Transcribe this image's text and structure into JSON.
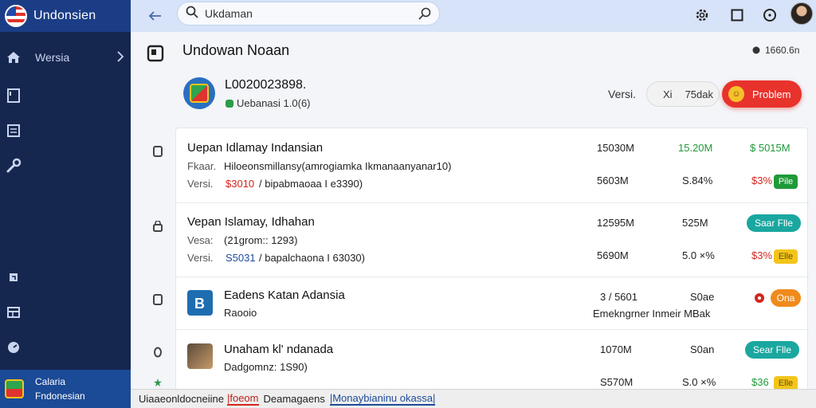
{
  "app": {
    "title": "Undonsien"
  },
  "sidebar": {
    "items": [
      {
        "label": "Wersia",
        "icon": "home-icon"
      },
      {
        "label": "",
        "icon": "document-icon"
      },
      {
        "label": "",
        "icon": "news-icon"
      },
      {
        "label": "",
        "icon": "wrench-icon"
      },
      {
        "label": "",
        "icon": "refresh-icon"
      },
      {
        "label": "",
        "icon": "table-icon"
      },
      {
        "label": "",
        "icon": "dashboard-icon"
      }
    ],
    "footer": {
      "line1": "Calaria",
      "line2": "Fndonesian"
    }
  },
  "topbar": {
    "search": {
      "value": "Ukdaman",
      "placeholder": "Ukdaman"
    },
    "icons": [
      "gear-icon",
      "square-icon",
      "help-icon",
      "avatar"
    ]
  },
  "page": {
    "title": "Undowan Noaan",
    "meta": "1660.6n"
  },
  "summary": {
    "id": "L0020023898.",
    "sub": "Uebanasi 1.0(6)",
    "versi_label": "Versi.",
    "version_x": "Xi",
    "version_value": "75dak",
    "problem_label": "Problem"
  },
  "rows": [
    {
      "title": "Uepan Idlamay Indansian",
      "line2_label": "Fkaar.",
      "line2_text": "Hiloeonsmillansy(amrogiamka Ikmanaanyanar10)",
      "line3_label": "Versi.",
      "line3_value": "$3010",
      "line3_text": "/ bipabmaoaa I e3390)",
      "col1_a": "15030M",
      "col2_a": "15.20M",
      "col3_a": "$ 5015M",
      "col1_b": "5603M",
      "col2_b": "S.84%",
      "col3_b": "$3%",
      "badge": "Pile"
    },
    {
      "title": "Vepan Islamay, Idhahan",
      "line2_label": "Vesa:",
      "line2_text": "(21grom:: 1293)",
      "line3_label": "Versi.",
      "line3_value": "S5031",
      "line3_text": "/ bapalchaona I 63030)",
      "col1_a": "12595M",
      "col2_a": "525M",
      "pill": "Saar Flle",
      "col1_b": "5690M",
      "col2_b": "5.0 ×%",
      "col3_b": "$3%",
      "badge": "Elle"
    },
    {
      "title": "Eadens Katan Adansia",
      "line2_text": "Raooio",
      "col1_a": "3 / 5601",
      "col2_a": "S0ae",
      "pill": "Ona",
      "line2_right": "Emekngrner Inmeir MBak"
    },
    {
      "title": "Unaham kl' ndanada",
      "line2_text": "Dadgomnz: 1S90)",
      "col1_a": "1070M",
      "col2_a": "S0an",
      "pill": "Sear Flle",
      "col1_b": "S570M",
      "col2_b": "S.0 ×%",
      "col3_b": "$36",
      "badge": "Elle"
    }
  ],
  "statusbar": {
    "seg1": "Uiaaeonldocneiine",
    "seg2": "|foeom",
    "seg3": "Deamagaens",
    "seg4": "|Monaybianinu okassa|"
  },
  "colors": {
    "sidebar": "#16274f",
    "brand": "#1b3d86",
    "accent_red": "#e8322c",
    "teal": "#1aa7a0",
    "orange": "#f08a1c",
    "yellow": "#f3c51b",
    "green": "#1f9a38"
  }
}
